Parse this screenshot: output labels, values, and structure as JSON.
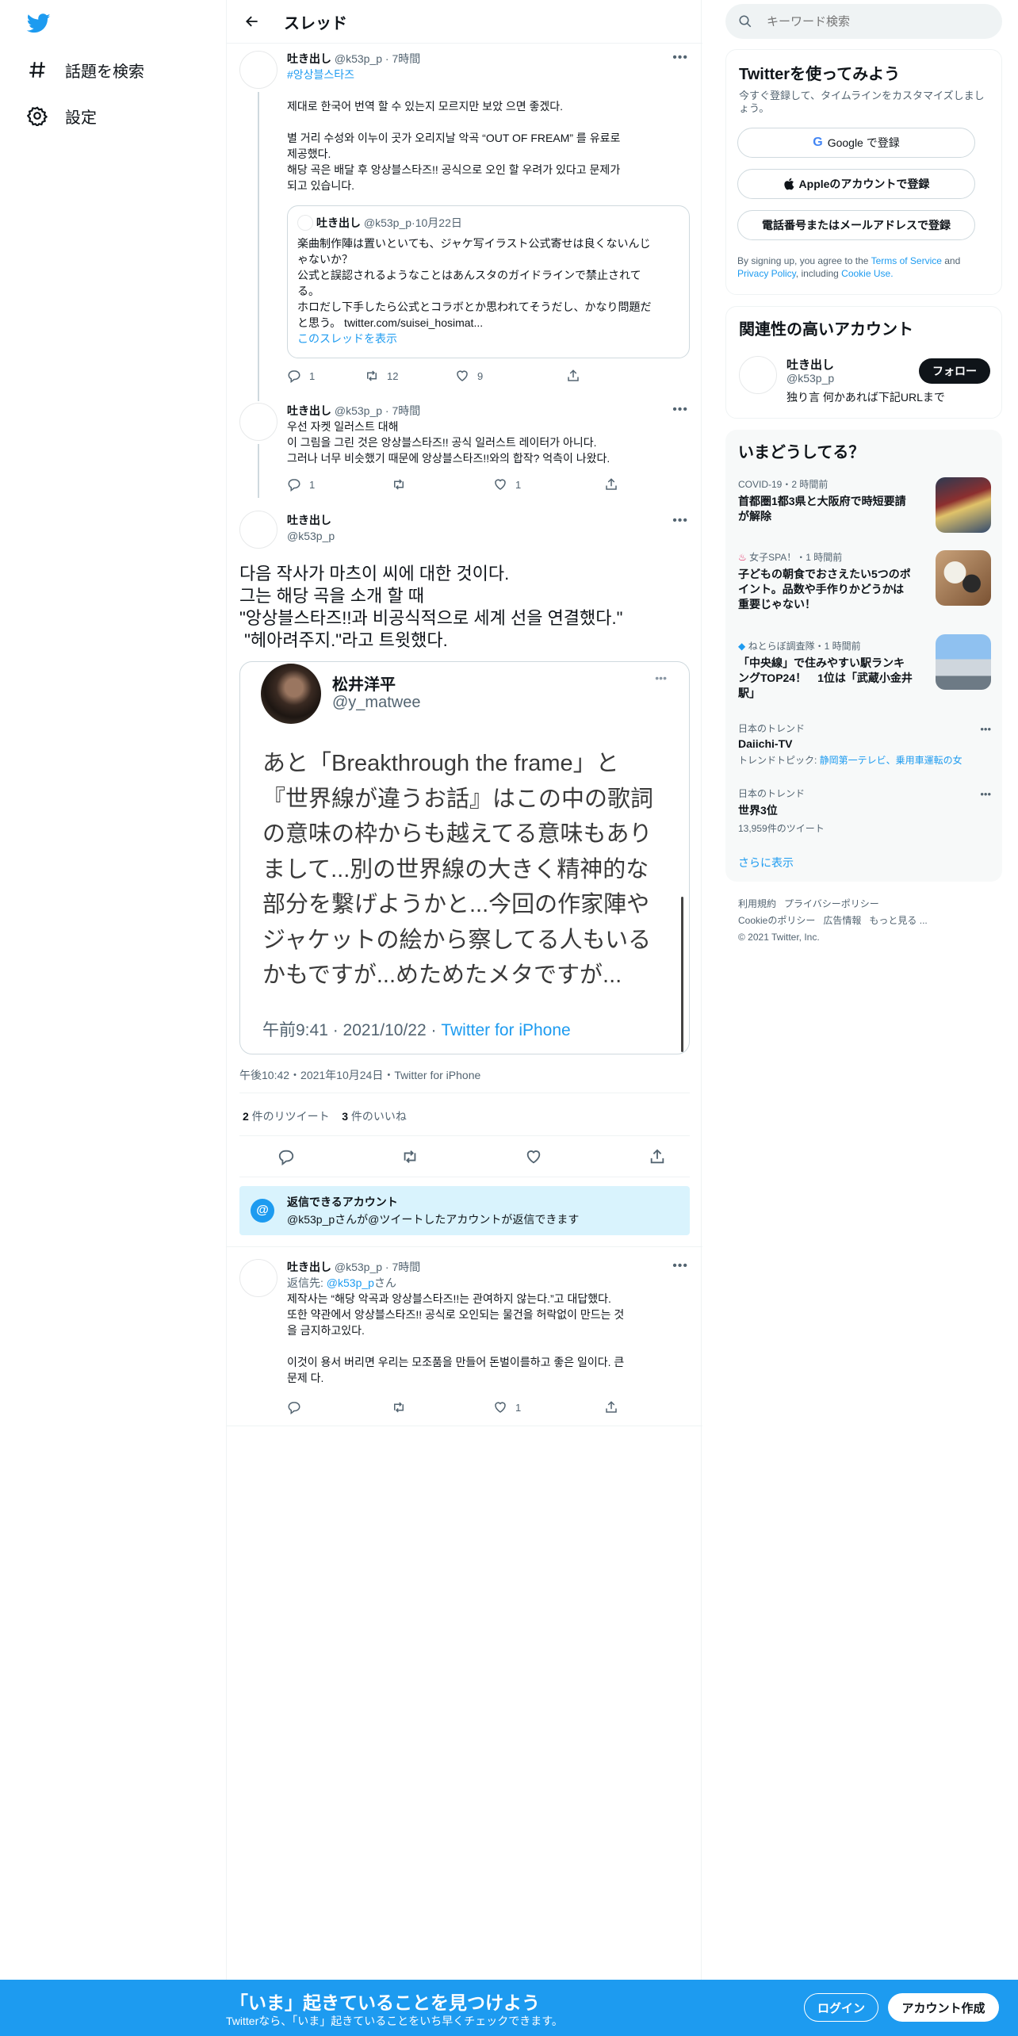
{
  "nav": {
    "explore_label": "話題を検索",
    "settings_label": "設定"
  },
  "header": {
    "title": "スレッド"
  },
  "tweet1": {
    "name": "吐き出し",
    "handle": "@k53p_p",
    "time": "7時間",
    "hashtag": "#앙상블스타즈",
    "line1": "제대로 한국어 번역 할 수 있는지 모르지만 보았 으면 좋겠다.",
    "line2": "별 거리 수성와 이누이 곳가 오리지날 악곡 “OUT OF FREAM” 를 유료로",
    "line3": "제공했다.",
    "line4": "해당 곡은 배달 후 앙상블스타즈!! 공식으로 오인 할 우려가 있다고 문제가",
    "line5": "되고 있습니다.",
    "quote": {
      "name": "吐き出し",
      "handle": "@k53p_p",
      "date": "10月22日",
      "line1": "楽曲制作陣は置いといても、ジャケ写イラスト公式寄せは良くないんじ",
      "line2": "ゃないか？",
      "line3": "公式と誤認されるようなことはあんスタのガイドラインで禁止されて",
      "line4": "る。",
      "line5": "ホロだし下手したら公式とコラボとか思われてそうだし、かなり問題だ",
      "line6": "と思う。 twitter.com/suisei_hosimat...",
      "show_thread": "このスレッドを表示"
    },
    "replies": "1",
    "retweets": "12",
    "likes": "9"
  },
  "tweet2": {
    "name": "吐き出し",
    "handle": "@k53p_p",
    "time": "7時間",
    "line1": "우선 자켓 일러스트 대해",
    "line2": "이 그림을 그린 것은 앙상블스타즈!! 공식 일러스트 레이터가 아니다.",
    "line3": "그러나 너무 비슷했기 때문에 앙상블스타즈!!와의 합작? 억측이 나왔다.",
    "replies": "1",
    "retweets": "",
    "likes": "1"
  },
  "main_tweet": {
    "name": "吐き出し",
    "handle": "@k53p_p",
    "line1": "다음 작사가 마츠이 씨에 대한 것이다.",
    "line2": "그는 해당 곡을 소개 할 때",
    "line3": "\"앙상블스타즈!!과 비공식적으로 세계 선을 연결했다.\"",
    "line4": " \"헤아려주지.\"라고 트윗했다.",
    "embedded": {
      "name": "松井洋平",
      "handle": "@y_matwee",
      "line1": "あと「Breakthrough the frame」と",
      "line2": "『世界線が違うお話』はこの中の歌詞",
      "line3": "の意味の枠からも越えてる意味もあり",
      "line4": "まして...別の世界線の大きく精神的な",
      "line5": "部分を繋げようかと...今回の作家陣や",
      "line6": "ジャケットの絵から察してる人もいる",
      "line7": "かもですが...めためたメタですが...",
      "time": "午前9:41 · 2021/10/22 · ",
      "source": "Twitter for iPhone"
    },
    "timestamp": "午後10:42・2021年10月24日・Twitter for iPhone",
    "retweet_count": "2",
    "retweet_label": " 件のリツイート",
    "like_count": "3",
    "like_label": " 件のいいね"
  },
  "reply_notice": {
    "title": "返信できるアカウント",
    "text": "@k53p_pさんが@ツイートしたアカウントが返信できます"
  },
  "tweet3": {
    "name": "吐き出し",
    "handle": "@k53p_p",
    "time": "7時間",
    "reply_to_prefix": "返信先: ",
    "reply_to_handle": "@k53p_p",
    "reply_to_suffix": "さん",
    "line1": "제작사는 “해당 악곡과 앙상블스타즈!!는 관여하지 않는다.”고 대답했다.",
    "line2": "또한 약관에서 앙상블스타즈!! 공식로 오인되는 물건을 허락없이 만드는 것",
    "line3": "을 금지하고있다.",
    "line4": "이것이 용서 버리면 우리는 모조품을 만들어 돈벌이를하고 좋은 일이다. 큰",
    "line5": "문제 다.",
    "likes": "1"
  },
  "right": {
    "search_placeholder": "キーワード検索",
    "signup": {
      "title": "Twitterを使ってみよう",
      "subtitle1": "今すぐ登録して、タイムラインをカスタマイズしまし",
      "subtitle2": "ょう。",
      "google": "Google で登録",
      "apple": "Appleのアカウントで登録",
      "phone": "電話番号またはメールアドレスで登録",
      "terms1": "By signing up, you agree to the ",
      "tos": "Terms of Service",
      "and": " and",
      "privacy": "Privacy Policy",
      "including": ", including ",
      "cookie": "Cookie Use."
    },
    "related": {
      "title": "関連性の高いアカウント",
      "name": "吐き出し",
      "handle": "@k53p_p",
      "bio": "独り言 何かあれば下記URLまで",
      "follow": "フォロー"
    },
    "trends": {
      "title": "いまどうしてる？",
      "items": [
        {
          "meta": "COVID-19・2 時間前",
          "text1": "首都圏1都3県と大阪府で時短要請",
          "text2": "が解除"
        },
        {
          "meta": "女子SPA！・1 時間前",
          "text1": "子どもの朝食でおさえたい5つのポ",
          "text2": "イント。品数や手作りかどうかは",
          "text3": "重要じゃない！"
        },
        {
          "meta": "ねとらぼ調査隊・1 時間前",
          "text1": "「中央線」で住みやすい駅ランキ",
          "text2": "ングTOP24！　1位は「武蔵小金井",
          "text3": "駅」"
        }
      ],
      "t4_meta": "日本のトレンド",
      "t4_name": "Daiichi-TV",
      "t4_topic_prefix": "トレンドトピック: ",
      "t4_topic": "静岡第一テレビ、乗用車運転の女",
      "t5_meta": "日本のトレンド",
      "t5_name": "世界3位",
      "t5_count": "13,959件のツイート",
      "show_more": "さらに表示"
    },
    "footer": {
      "l1a": "利用規約",
      "l1b": "プライバシーポリシー",
      "l2a": "Cookieのポリシー",
      "l2b": "広告情報",
      "l2c": "もっと見る ...",
      "copy": "© 2021 Twitter, Inc."
    }
  },
  "banner": {
    "title": "「いま」起きていることを見つけよう",
    "subtitle": "Twitterなら、「いま」起きていることをいち早くチェックできます。",
    "login": "ログイン",
    "signup": "アカウント作成"
  },
  "colors": {
    "brand": "#1d9bf0",
    "text": "#0f1419",
    "secondary": "#536471",
    "notice_bg": "#d9f3fd"
  }
}
